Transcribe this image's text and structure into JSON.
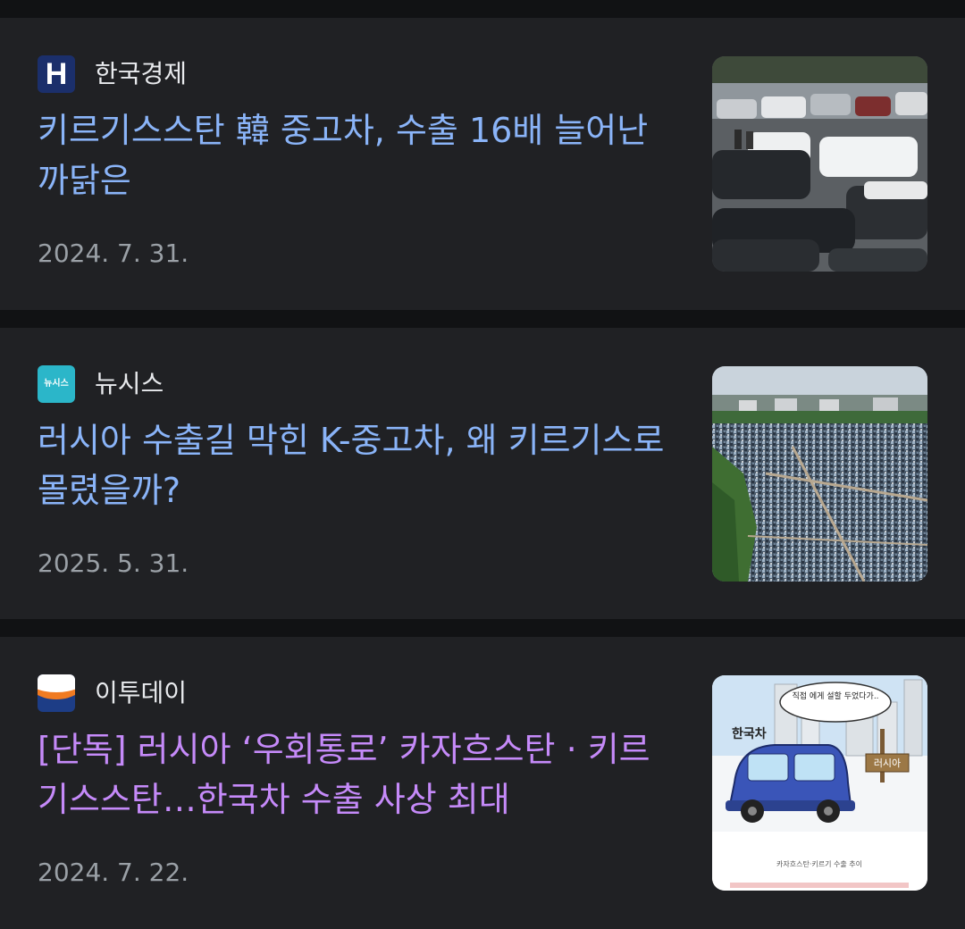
{
  "articles": [
    {
      "source": "한국경제",
      "logo": "hankyung-logo-icon",
      "logo_text": "H",
      "title": "키르기스스탄 韓 중고차, 수출 16배 늘어난 까닭은",
      "date": "2024. 7. 31.",
      "thumbnail": "parked-cars-photo",
      "visited": false
    },
    {
      "source": "뉴시스",
      "logo": "newsis-logo-icon",
      "logo_text": "뉴시스",
      "title": "러시아 수출길 막힌 K-중고차, 왜 키르기스로 몰렸을까?",
      "date": "2025. 5. 31.",
      "thumbnail": "used-car-lot-aerial-photo",
      "visited": false
    },
    {
      "source": "이투데이",
      "logo": "etoday-logo-icon",
      "title": "[단독] 러시아 ‘우회통로’ 카자흐스탄 · 키르기스스탄…한국차 수출 사상 최대",
      "date": "2024. 7. 22.",
      "thumbnail": "korean-car-cartoon-illustration",
      "thumbnail_text": {
        "car_label": "한국차",
        "sign_label": "러시아",
        "speech": "직접 에게 설할 두었다가..",
        "caption": "카자흐스탄·키르기 수출 추이"
      },
      "visited": true
    }
  ],
  "colors": {
    "background": "#111214",
    "card": "#202124",
    "title_link": "#8ab4f8",
    "title_visited": "#c58af9",
    "source_text": "#e8eaed",
    "date_text": "#9aa0a6"
  }
}
